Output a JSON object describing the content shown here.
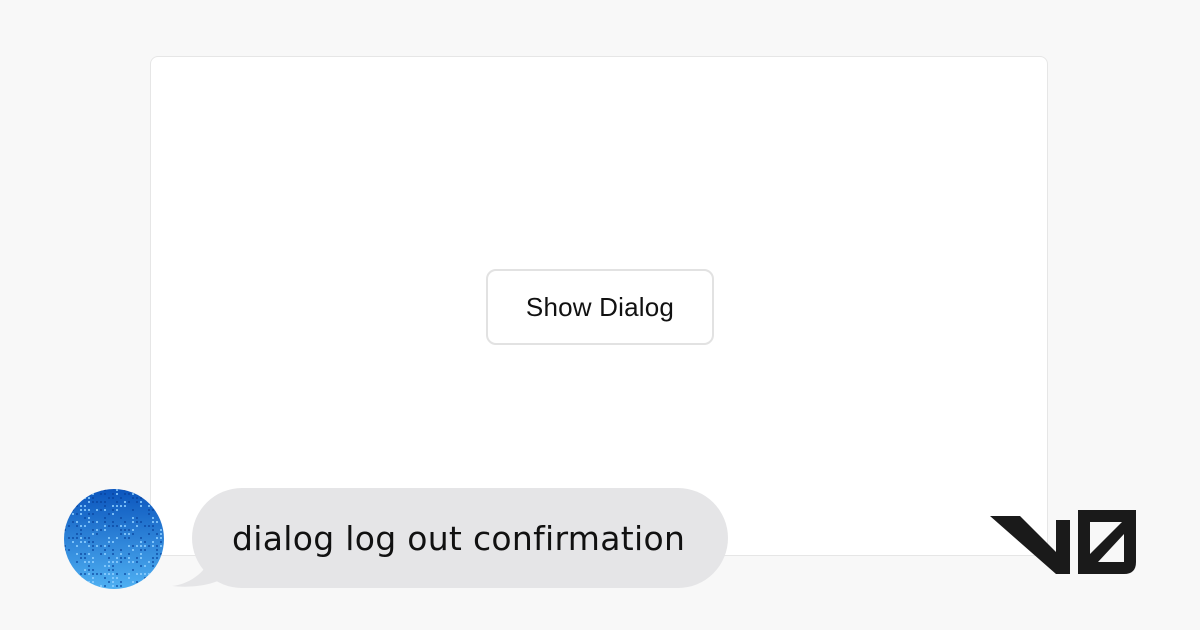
{
  "preview": {
    "show_dialog_label": "Show Dialog"
  },
  "chat": {
    "prompt_text": "dialog log out confirmation"
  },
  "colors": {
    "page_background": "#f8f8f8",
    "card_background": "#ffffff",
    "bubble_background": "#e5e5e7",
    "avatar_dark": "#0a5cc4",
    "avatar_light": "#5bb8f5",
    "logo": "#1a1a1a"
  },
  "icons": {
    "avatar": "pixel-gradient-avatar",
    "brand": "v0-logo"
  }
}
